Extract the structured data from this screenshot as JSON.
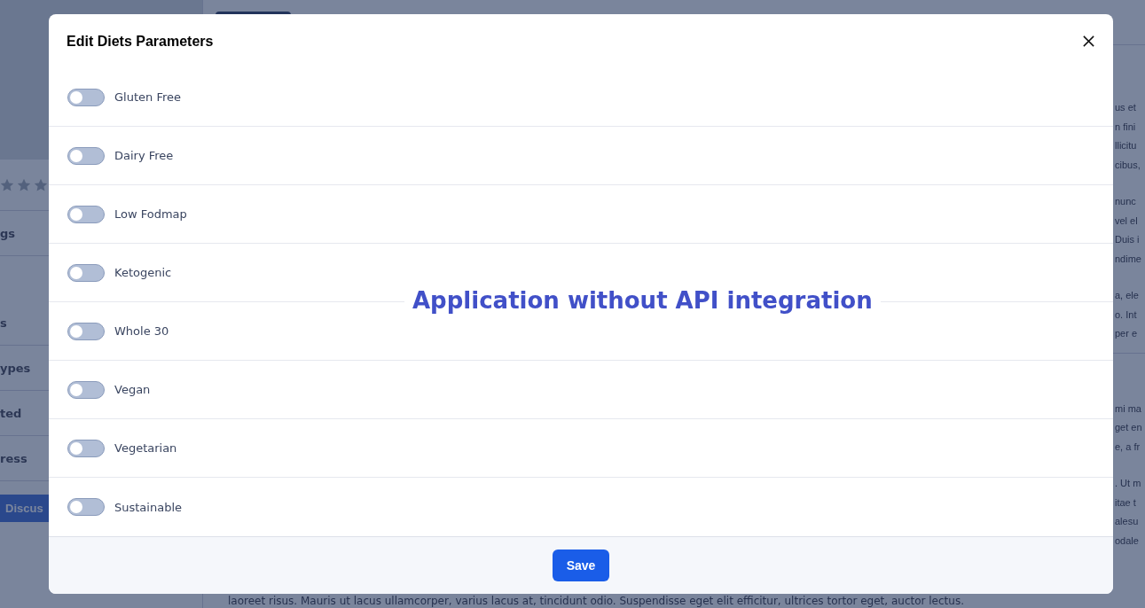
{
  "background": {
    "nav_items": [
      "gs",
      "s",
      "ypes",
      "ted",
      "ress"
    ],
    "discuss_button": "Discus",
    "text_blocks": [
      [
        "us et",
        "n fini",
        "llicitu",
        "cibus,"
      ],
      [
        "nunc",
        "vel el",
        "Duis i",
        "ndime"
      ],
      [
        "a, ele",
        "o. Int",
        "per e"
      ],
      [
        "mi ma",
        "get en",
        "e, a fr"
      ],
      [
        ". Ut m",
        "itae t",
        "alesu",
        "odale"
      ]
    ],
    "bottom_line": "laoreet risus. Mauris ut lacus ullamcorper, varius lacus at, tincidunt odio. Suspendisse eget elit efficitur, ultrices tortor eget, auctor lectus."
  },
  "dialog": {
    "title": "Edit Diets Parameters",
    "options": [
      {
        "label": "Gluten Free",
        "on": false
      },
      {
        "label": "Dairy Free",
        "on": false
      },
      {
        "label": "Low Fodmap",
        "on": false
      },
      {
        "label": "Ketogenic",
        "on": false
      },
      {
        "label": "Whole 30",
        "on": false
      },
      {
        "label": "Vegan",
        "on": false
      },
      {
        "label": "Vegetarian",
        "on": false
      },
      {
        "label": "Sustainable",
        "on": false
      }
    ],
    "save_button": "Save"
  },
  "annotation": "Application without API integration"
}
